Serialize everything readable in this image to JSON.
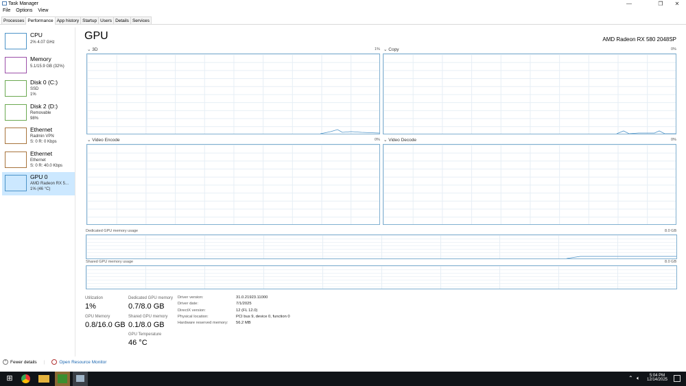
{
  "window": {
    "title": "Task Manager",
    "minimize": "—",
    "restore": "❐",
    "close": "✕"
  },
  "menu": [
    "File",
    "Options",
    "View"
  ],
  "tabs": [
    "Processes",
    "Performance",
    "App history",
    "Startup",
    "Users",
    "Details",
    "Services"
  ],
  "sidebar": [
    {
      "name": "CPU",
      "sub1": "2% 4.07 GHz",
      "sub2": "",
      "color": "#4c93c8"
    },
    {
      "name": "Memory",
      "sub1": "5.1/15.9 GB (32%)",
      "sub2": "",
      "color": "#9b4ea8"
    },
    {
      "name": "Disk 0 (C:)",
      "sub1": "SSD",
      "sub2": "1%",
      "color": "#6aa84f"
    },
    {
      "name": "Disk 2 (D:)",
      "sub1": "Removable",
      "sub2": "98%",
      "color": "#6aa84f"
    },
    {
      "name": "Ethernet",
      "sub1": "Radmin VPN",
      "sub2": "S: 0 R: 0 Kbps",
      "color": "#a7723a"
    },
    {
      "name": "Ethernet",
      "sub1": "Ethernet",
      "sub2": "S: 0 R: 40.0 Kbps",
      "color": "#a7723a"
    },
    {
      "name": "GPU 0",
      "sub1": "AMD Radeon RX 5...",
      "sub2": "1% (46 °C)",
      "color": "#4c93c8"
    }
  ],
  "main": {
    "title": "GPU",
    "gpu_name": "AMD Radeon RX 580 2048SP",
    "graphs": [
      {
        "label": "3D",
        "pct": "1%"
      },
      {
        "label": "Copy",
        "pct": "0%"
      },
      {
        "label": "Video Encode",
        "pct": "0%"
      },
      {
        "label": "Video Decode",
        "pct": "0%"
      }
    ],
    "dedicated": {
      "label": "Dedicated GPU memory usage",
      "max": "8.0 GB"
    },
    "shared": {
      "label": "Shared GPU memory usage",
      "max": "8.0 GB"
    },
    "stats": {
      "utilization_label": "Utilization",
      "utilization": "1%",
      "gpu_memory_label": "GPU Memory",
      "gpu_memory": "0.8/16.0 GB",
      "dedicated_label": "Dedicated GPU memory",
      "dedicated": "0.7/8.0 GB",
      "shared_label": "Shared GPU memory",
      "shared": "0.1/8.0 GB",
      "temp_label": "GPU Temperature",
      "temp": "46 °C"
    },
    "details": [
      {
        "k": "Driver version:",
        "v": "31.0.21923.11000"
      },
      {
        "k": "Driver date:",
        "v": "7/1/2025"
      },
      {
        "k": "DirectX version:",
        "v": "12 (FL 12.0)"
      },
      {
        "k": "Physical location:",
        "v": "PCI bus 9, device 0, function 0"
      },
      {
        "k": "Hardware reserved memory:",
        "v": "56.2 MB"
      }
    ]
  },
  "footer": {
    "fewer": "Fewer details",
    "monitor": "Open Resource Monitor"
  },
  "taskbar": {
    "time": "5:04 PM",
    "date": "12/14/2025"
  }
}
